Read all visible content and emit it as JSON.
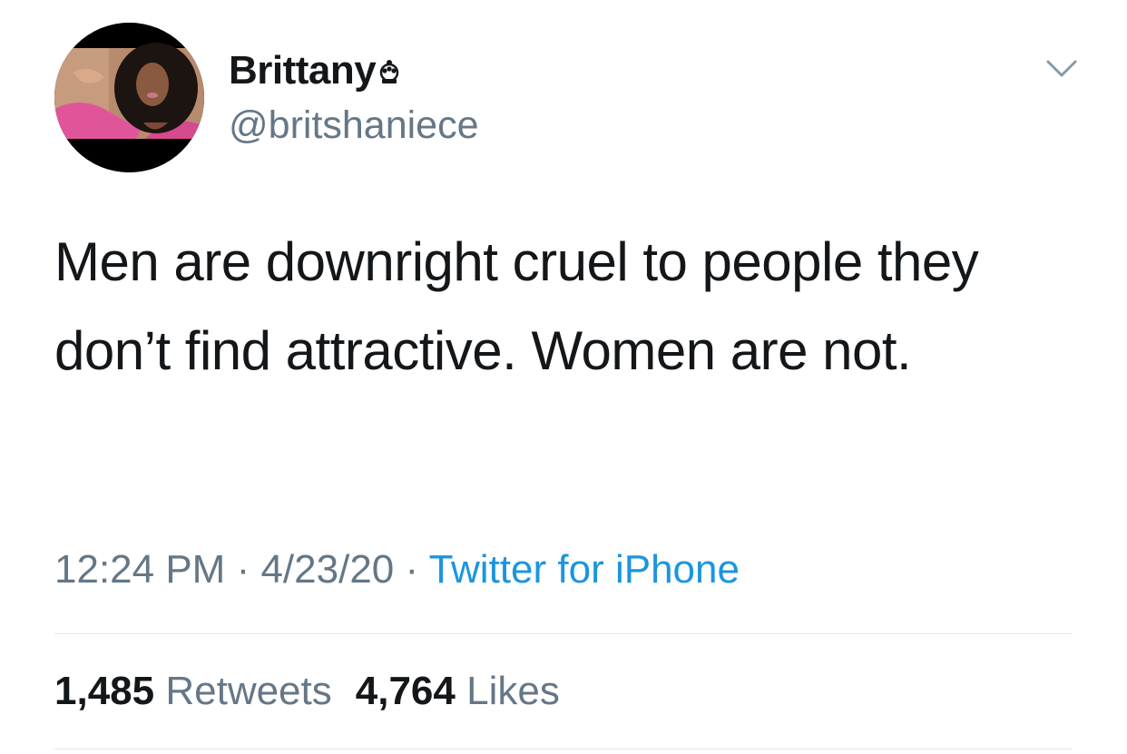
{
  "author": {
    "display_name": "Brittany",
    "handle": "@britshaniece",
    "badge_icon": "crown-icon",
    "avatar_icon": "profile-photo"
  },
  "menu_icon": "chevron-down-icon",
  "tweet": {
    "text": "Men are downright cruel to people they don’t find attractive. Women are not."
  },
  "meta": {
    "time": "12:24 PM",
    "separator": " · ",
    "date": "4/23/20",
    "source": "Twitter for iPhone"
  },
  "stats": {
    "retweets_count": "1,485",
    "retweets_label": "Retweets",
    "likes_count": "4,764",
    "likes_label": "Likes"
  },
  "colors": {
    "text_primary": "#14171a",
    "text_secondary": "#657786",
    "link": "#1b95e0",
    "divider": "#e1e8ed"
  }
}
